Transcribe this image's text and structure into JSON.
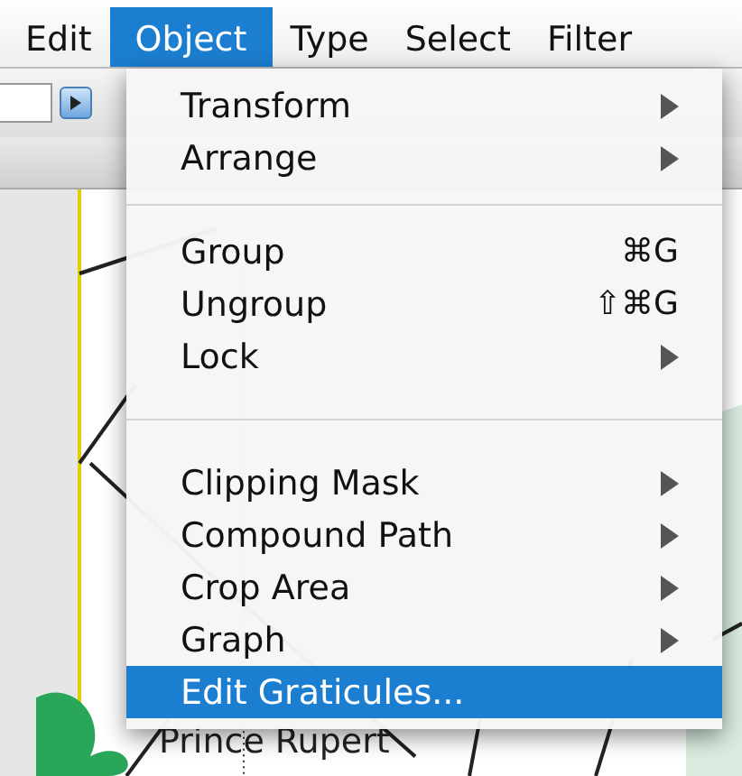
{
  "menu_bar": [
    {
      "label": "Edit",
      "selected": false
    },
    {
      "label": "Object",
      "selected": true
    },
    {
      "label": "Type",
      "selected": false
    },
    {
      "label": "Select",
      "selected": false
    },
    {
      "label": "Filter",
      "selected": false
    }
  ],
  "menu": {
    "items": [
      {
        "kind": "submenu",
        "label": "Transform",
        "selected": false
      },
      {
        "kind": "submenu",
        "label": "Arrange",
        "selected": false
      },
      {
        "kind": "separator"
      },
      {
        "kind": "command",
        "label": "Group",
        "shortcut": "⌘G",
        "selected": false
      },
      {
        "kind": "command",
        "label": "Ungroup",
        "shortcut": "⇧⌘G",
        "selected": false
      },
      {
        "kind": "submenu",
        "label": "Lock",
        "selected": false
      },
      {
        "kind": "spacer"
      },
      {
        "kind": "separator"
      },
      {
        "kind": "spacer"
      },
      {
        "kind": "submenu",
        "label": "Clipping Mask",
        "selected": false
      },
      {
        "kind": "submenu",
        "label": "Compound Path",
        "selected": false
      },
      {
        "kind": "submenu",
        "label": "Crop Area",
        "selected": false
      },
      {
        "kind": "submenu",
        "label": "Graph",
        "selected": false
      },
      {
        "kind": "command",
        "label": "Edit Graticules...",
        "selected": true
      }
    ]
  },
  "map": {
    "place_label": "Prince Rupert"
  }
}
